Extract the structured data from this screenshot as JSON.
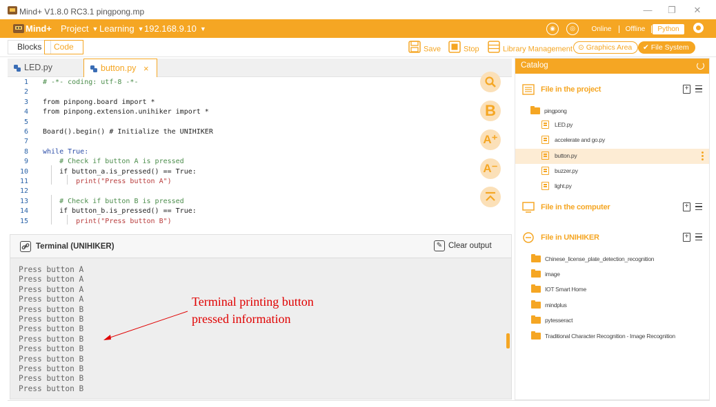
{
  "window": {
    "title": "Mind+ V1.8.0 RC3.1   pingpong.mp",
    "minimize": "—",
    "restore": "❐",
    "close": "✕"
  },
  "menubar": {
    "logo_text": "Mind+",
    "items": [
      {
        "label": "Project"
      },
      {
        "label": "Learning"
      },
      {
        "label": "192.168.9.10"
      }
    ],
    "modes": {
      "online": "Online",
      "offline": "Offline",
      "python": "Python",
      "active": "python"
    }
  },
  "toolbar": {
    "blocks": "Blocks",
    "code": "Code",
    "save": "Save",
    "stop": "Stop",
    "library": "Library Management",
    "graphics": "Graphics Area",
    "filesystem": "File System"
  },
  "editor": {
    "tabs": [
      {
        "label": "LED.py",
        "active": false
      },
      {
        "label": "button.py",
        "active": true
      }
    ],
    "close_glyph": "×",
    "side_tools": [
      "search-icon",
      "blocks-icon",
      "zoom-in-icon",
      "zoom-out-icon",
      "collapse-icon"
    ],
    "side_labels": {
      "b": "B",
      "zoom_in": "A⁺",
      "zoom_out": "A⁻"
    },
    "lines": [
      {
        "n": "1",
        "text": "# -*- coding: utf-8 -*-"
      },
      {
        "n": "2",
        "text": ""
      },
      {
        "n": "3",
        "text": "from pinpong.board import *"
      },
      {
        "n": "4",
        "text": "from pinpong.extension.unihiker import *"
      },
      {
        "n": "5",
        "text": ""
      },
      {
        "n": "6",
        "text": "Board().begin() # Initialize the UNIHIKER"
      },
      {
        "n": "7",
        "text": ""
      },
      {
        "n": "8",
        "text": "while True:"
      },
      {
        "n": "9",
        "text": "    # Check if button A is pressed"
      },
      {
        "n": "10",
        "text": "    if button_a.is_pressed() == True:"
      },
      {
        "n": "11",
        "text": "        print(\"Press button A\")"
      },
      {
        "n": "12",
        "text": ""
      },
      {
        "n": "13",
        "text": "    # Check if button B is pressed"
      },
      {
        "n": "14",
        "text": "    if button_b.is_pressed() == True:"
      },
      {
        "n": "15",
        "text": "        print(\"Press button B\")"
      }
    ]
  },
  "terminal": {
    "title": "Terminal (UNIHIKER)",
    "clear": "Clear output",
    "output": [
      "Press button A",
      "Press button A",
      "Press button A",
      "Press button A",
      "Press button B",
      "Press button B",
      "Press button B",
      "Press button B",
      "Press button B",
      "Press button B",
      "Press button B",
      "Press button B",
      "Press button B"
    ]
  },
  "annotation": {
    "line1": "Terminal printing button",
    "line2": "pressed information"
  },
  "catalog": {
    "title": "Catalog",
    "project": {
      "title": "File in the project",
      "folder": "pingpong",
      "files": [
        "LED.py",
        "accelerate and go.py",
        "button.py",
        "buzzer.py",
        "light.py"
      ],
      "selected": "button.py"
    },
    "computer": {
      "title": "File in the computer"
    },
    "unihiker": {
      "title": "File in UNIHIKER",
      "folders": [
        "Chinese_license_plate_detection_recognition",
        "image",
        "IOT Smart Home",
        "mindplus",
        "pytesseract",
        "Traditional Character Recognition - Image Recognition"
      ]
    }
  },
  "colors": {
    "accent": "#f5a623",
    "annotation": "#e00000",
    "selected_row": "#fdecd4"
  }
}
